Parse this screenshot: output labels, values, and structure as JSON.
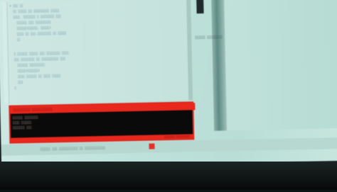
{
  "editor": {
    "lines": [
      "> ░░░ ░░",
      "  ░░ ░░░░░ ░░ ░░░░░░░░░ ░░░░░",
      "  ░░░░  ░░░░░░░ ░ ░░░░░░░░ ░░░",
      "    ░░░░░░ ░░░ ░░░░░░░░░",
      "    ░░░░░░(░░░░░, ░░░░░)",
      "    ░░░░ ░░ ░░░ ░░░░░░░░ ░░ ░░░░░",
      "    ░░",
      "",
      "  ░ ░░░░░░ ░░░░░ ░░░ ░░░░░░░░ ░░░░",
      "  ░░░ ░░░░░░░░ ░░ ░░░░░░░░░░ ░░░",
      "    ░░░░░░ ░░░░░░░░░",
      "    ░░░░░(░░░░░░)",
      "    ░░░░ ░░░░░░ ░░ ░░░░ ░░░░░",
      "    ░░░",
      "  ░"
    ]
  },
  "right_pane": {
    "label": "░░░░░░ ░░░░░░░░░"
  },
  "console": {
    "header": "░░░░░░░░░░ ░░░░░░░░░░░░",
    "lines": [
      "░░░░░░ ░░░░░░░░",
      "░░░░ ░░░░░░",
      "░░░░░░░ ░░░"
    ],
    "footer": "░░░░░░░░ ░░░░░░░░░░░"
  },
  "status_bar": {
    "text": "░░░░░░ ░░░ ░░░░░░░░░░░ ░░ ░░░░░░░░░░░░",
    "icon": "stop-icon"
  },
  "colors": {
    "screen_bg": "#bfe3dc",
    "code_text": "#4a7f93",
    "console_bg": "#0a0a0a",
    "console_accent": "#e8271d",
    "bezel": "#0b0f0f"
  }
}
